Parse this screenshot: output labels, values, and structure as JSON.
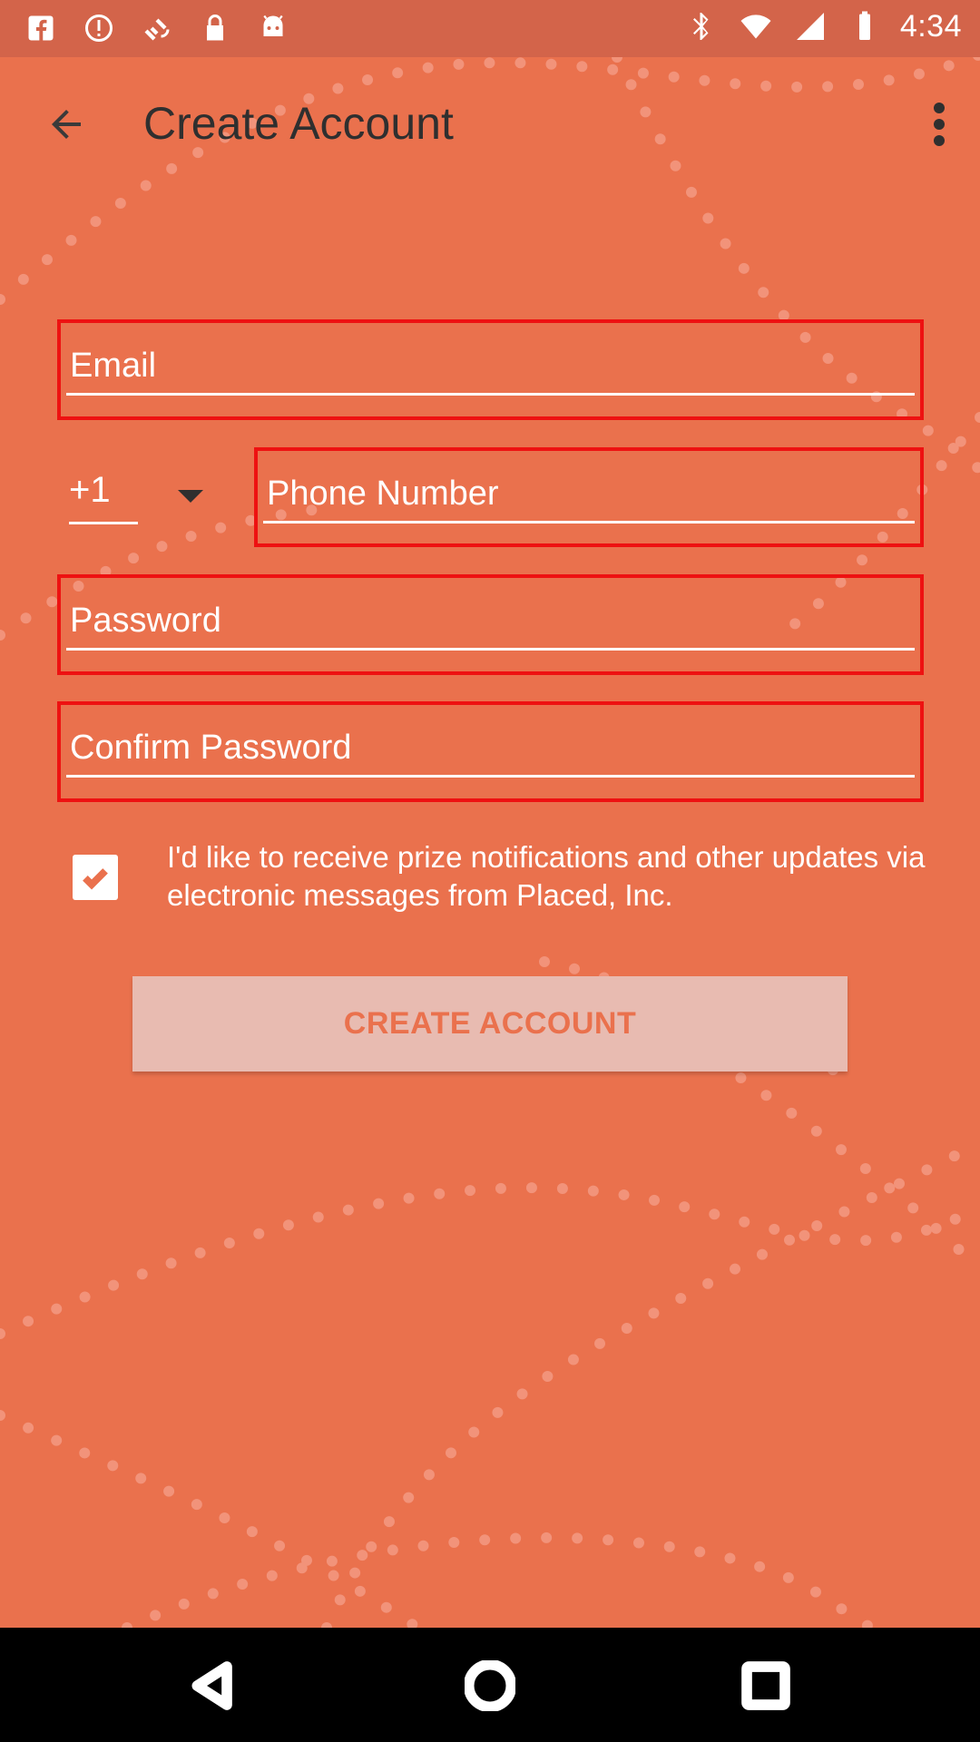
{
  "status_bar": {
    "time": "4:34",
    "left_icons": [
      "facebook-icon",
      "alert-icon",
      "satellite-icon",
      "lock-icon",
      "android-icon"
    ],
    "right_icons": [
      "bluetooth-icon",
      "wifi-icon",
      "signal-icon",
      "battery-icon"
    ]
  },
  "app_bar": {
    "title": "Create Account",
    "back_icon": "arrow-back-icon",
    "menu_icon": "more-vert-icon"
  },
  "form": {
    "email": {
      "placeholder": "Email",
      "value": ""
    },
    "country_code": {
      "value": "+1"
    },
    "phone": {
      "placeholder": "Phone Number",
      "value": ""
    },
    "password": {
      "placeholder": "Password",
      "value": ""
    },
    "confirm_password": {
      "placeholder": "Confirm Password",
      "value": ""
    },
    "highlight_color": "#ee1111"
  },
  "consent": {
    "checked": true,
    "text": "I'd like to receive prize notifications and other updates via electronic messages from Placed, Inc."
  },
  "create_button": {
    "label": "CREATE ACCOUNT"
  },
  "colors": {
    "background": "#ea714d",
    "status_bar": "#d3644a",
    "button_bg": "#e8bbb1"
  },
  "nav_bar": {
    "icons": [
      "back-triangle-icon",
      "home-circle-icon",
      "recents-square-icon"
    ]
  }
}
